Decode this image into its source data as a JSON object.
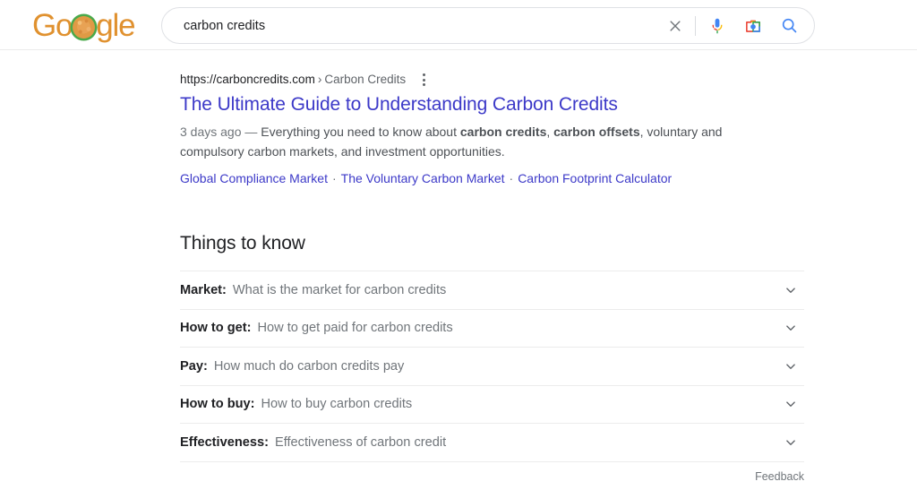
{
  "header": {
    "logo": {
      "name": "google-doodle-logo",
      "letters_before": "Go",
      "letters_after": "gle",
      "text_color": "#e0912f",
      "doodle_ring_color": "#4aa94a",
      "doodle_fill_color": "#e09a45"
    },
    "search": {
      "value": "carbon credits",
      "placeholder": "Search",
      "clear_icon": "close-icon",
      "voice_icon": "microphone-icon",
      "lens_icon": "google-lens-camera-icon",
      "submit_icon": "search-icon",
      "submit_icon_color": "#4285f4"
    }
  },
  "result": {
    "url_domain": "https://carboncredits.com",
    "url_separator": "›",
    "url_breadcrumb": "Carbon Credits",
    "menu_icon": "three-dot-menu-icon",
    "title": "The Ultimate Guide to Understanding Carbon Credits",
    "title_color": "#3c39c8",
    "snippet": {
      "date": "3 days ago",
      "dash": "—",
      "part1": "Everything you need to know about ",
      "bold1": "carbon credits",
      "part2": ", ",
      "bold2": "carbon offsets",
      "part3": ", voluntary and compulsory carbon markets, and investment opportunities."
    },
    "sitelinks": [
      "Global Compliance Market",
      "The Voluntary Carbon Market",
      "Carbon Footprint Calculator"
    ],
    "sitelink_separator": "·"
  },
  "things_to_know": {
    "heading": "Things to know",
    "expand_icon": "chevron-down-icon",
    "rows": [
      {
        "label": "Market:",
        "question": "What is the market for carbon credits"
      },
      {
        "label": "How to get:",
        "question": "How to get paid for carbon credits"
      },
      {
        "label": "Pay:",
        "question": "How much do carbon credits pay"
      },
      {
        "label": "How to buy:",
        "question": "How to buy carbon credits"
      },
      {
        "label": "Effectiveness:",
        "question": "Effectiveness of carbon credit"
      }
    ],
    "feedback_label": "Feedback"
  }
}
